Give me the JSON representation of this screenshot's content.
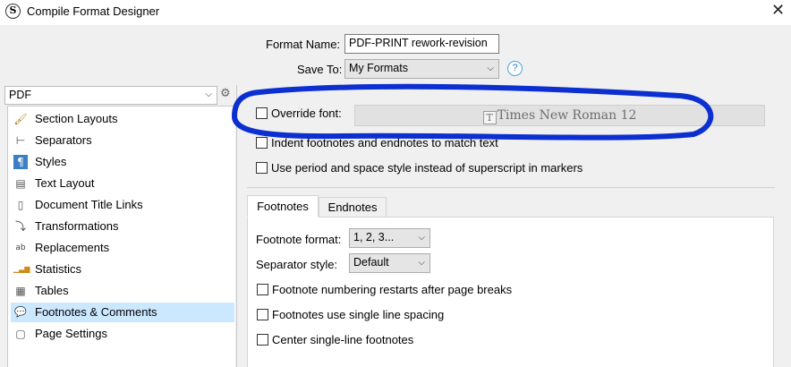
{
  "window": {
    "title": "Compile Format Designer",
    "app_icon_letter": "S",
    "close_glyph": "✕"
  },
  "header": {
    "format_name_label": "Format Name:",
    "format_name_value": "PDF-PRINT rework-revision",
    "save_to_label": "Save To:",
    "save_to_value": "My Formats",
    "help_glyph": "?"
  },
  "sidebar": {
    "format_select": "PDF",
    "items": [
      {
        "label": "Section Layouts",
        "icon": "paintbrush-icon",
        "glyph": "🖌"
      },
      {
        "label": "Separators",
        "icon": "separators-icon",
        "glyph": "⊢"
      },
      {
        "label": "Styles",
        "icon": "styles-icon",
        "glyph": "¶"
      },
      {
        "label": "Text Layout",
        "icon": "text-layout-icon",
        "glyph": "▤"
      },
      {
        "label": "Document Title Links",
        "icon": "document-icon",
        "glyph": "▯"
      },
      {
        "label": "Transformations",
        "icon": "transformations-icon",
        "glyph": "⤵"
      },
      {
        "label": "Replacements",
        "icon": "replacements-icon",
        "glyph": "ab"
      },
      {
        "label": "Statistics",
        "icon": "bar-chart-icon",
        "glyph": "▁▃▆"
      },
      {
        "label": "Tables",
        "icon": "table-icon",
        "glyph": "▦"
      },
      {
        "label": "Footnotes & Comments",
        "icon": "comment-icon",
        "glyph": "💬",
        "selected": true
      },
      {
        "label": "Page Settings",
        "icon": "page-icon",
        "glyph": "▢"
      }
    ]
  },
  "main": {
    "override_font_label": "Override font:",
    "override_font_checked": false,
    "font_button": {
      "icon_glyph": "T",
      "label": "Times New Roman 12"
    },
    "indent_footnotes_label": "Indent footnotes and endnotes to match text",
    "period_space_label": "Use period and space style instead of superscript in markers",
    "tabs": [
      {
        "label": "Footnotes",
        "active": true
      },
      {
        "label": "Endnotes",
        "active": false
      }
    ],
    "footnote_format_label": "Footnote format:",
    "footnote_format_value": "1, 2, 3...",
    "separator_style_label": "Separator style:",
    "separator_style_value": "Default",
    "restart_label": "Footnote numbering restarts after page breaks",
    "single_spacing_label": "Footnotes use single line spacing",
    "center_label": "Center single-line footnotes"
  },
  "colors": {
    "selection": "#cce8ff",
    "annotation": "#0b2fd1",
    "panel_bg": "#f0f0f0"
  }
}
